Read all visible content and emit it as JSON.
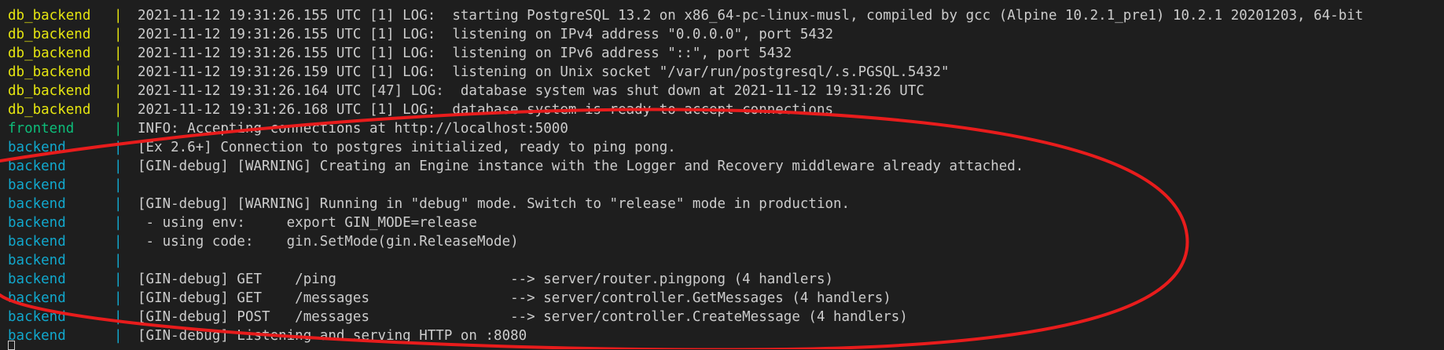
{
  "colors": {
    "background": "#1e1e1e",
    "text": "#cccccc",
    "db_backend": "#e5e510",
    "frontend": "#0dbc79",
    "backend": "#11a8cd",
    "annotation": "#e81c1c"
  },
  "separator": "|",
  "lines": [
    {
      "service": "db_backend",
      "message": "2021-11-12 19:31:26.155 UTC [1] LOG:  starting PostgreSQL 13.2 on x86_64-pc-linux-musl, compiled by gcc (Alpine 10.2.1_pre1) 10.2.1 20201203, 64-bit"
    },
    {
      "service": "db_backend",
      "message": "2021-11-12 19:31:26.155 UTC [1] LOG:  listening on IPv4 address \"0.0.0.0\", port 5432"
    },
    {
      "service": "db_backend",
      "message": "2021-11-12 19:31:26.155 UTC [1] LOG:  listening on IPv6 address \"::\", port 5432"
    },
    {
      "service": "db_backend",
      "message": "2021-11-12 19:31:26.159 UTC [1] LOG:  listening on Unix socket \"/var/run/postgresql/.s.PGSQL.5432\""
    },
    {
      "service": "db_backend",
      "message": "2021-11-12 19:31:26.164 UTC [47] LOG:  database system was shut down at 2021-11-12 19:31:26 UTC"
    },
    {
      "service": "db_backend",
      "message": "2021-11-12 19:31:26.168 UTC [1] LOG:  database system is ready to accept connections"
    },
    {
      "service": "frontend",
      "message": "INFO: Accepting connections at http://localhost:5000"
    },
    {
      "service": "backend",
      "message": "[Ex 2.6+] Connection to postgres initialized, ready to ping pong."
    },
    {
      "service": "backend",
      "message": "[GIN-debug] [WARNING] Creating an Engine instance with the Logger and Recovery middleware already attached."
    },
    {
      "service": "backend",
      "message": ""
    },
    {
      "service": "backend",
      "message": "[GIN-debug] [WARNING] Running in \"debug\" mode. Switch to \"release\" mode in production."
    },
    {
      "service": "backend",
      "message": " - using env:     export GIN_MODE=release"
    },
    {
      "service": "backend",
      "message": " - using code:    gin.SetMode(gin.ReleaseMode)"
    },
    {
      "service": "backend",
      "message": ""
    },
    {
      "service": "backend",
      "message": "[GIN-debug] GET    /ping                     --> server/router.pingpong (4 handlers)"
    },
    {
      "service": "backend",
      "message": "[GIN-debug] GET    /messages                 --> server/controller.GetMessages (4 handlers)"
    },
    {
      "service": "backend",
      "message": "[GIN-debug] POST   /messages                 --> server/controller.CreateMessage (4 handlers)"
    },
    {
      "service": "backend",
      "message": "[GIN-debug] Listening and serving HTTP on :8080"
    }
  ]
}
